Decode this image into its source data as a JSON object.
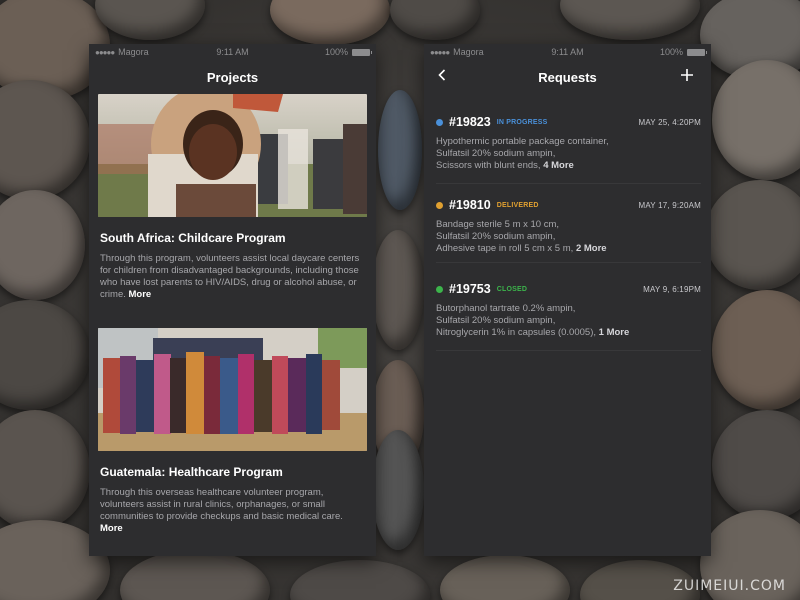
{
  "status_bar": {
    "carrier": "Magora",
    "time": "9:11 AM",
    "battery": "100%"
  },
  "projects": {
    "title": "Projects",
    "items": [
      {
        "title": "South Africa: Childcare Program",
        "description": "Through this program, volunteers assist local daycare centers for children from disadvantaged backgrounds, including those who have lost parents to HIV/AIDS, drug or alcohol abuse, or crime.",
        "more": "More"
      },
      {
        "title": "Guatemala: Healthcare Program",
        "description": "Through this overseas healthcare volunteer program, volunteers assist in rural clinics, orphanages, or small communities to provide checkups and basic medical care.",
        "more": "More"
      }
    ]
  },
  "requests": {
    "title": "Requests",
    "items": [
      {
        "id": "#19823",
        "status": "IN PROGRESS",
        "status_color": "#4a90d9",
        "date": "MAY 25, 4:20PM",
        "lines": [
          "Hypothermic portable package container,",
          "Sulfatsil 20% sodium ampin,",
          "Scissors with blunt ends,"
        ],
        "more": "4 More"
      },
      {
        "id": "#19810",
        "status": "DELIVERED",
        "status_color": "#e0a030",
        "date": "MAY 17, 9:20AM",
        "lines": [
          "Bandage sterile 5 m x 10 cm,",
          "Sulfatsil 20% sodium ampin,",
          "Adhesive tape in roll 5 cm x 5 m,"
        ],
        "more": "2 More"
      },
      {
        "id": "#19753",
        "status": "CLOSED",
        "status_color": "#3cb44b",
        "date": "MAY 9, 6:19PM",
        "lines": [
          "Butorphanol tartrate 0.2% ampin,",
          "Sulfatsil 20% sodium ampin,",
          "Nitroglycerin 1% in capsules (0.0005),"
        ],
        "more": "1 More"
      }
    ]
  },
  "watermark": "ZUIMEIUI.COM"
}
